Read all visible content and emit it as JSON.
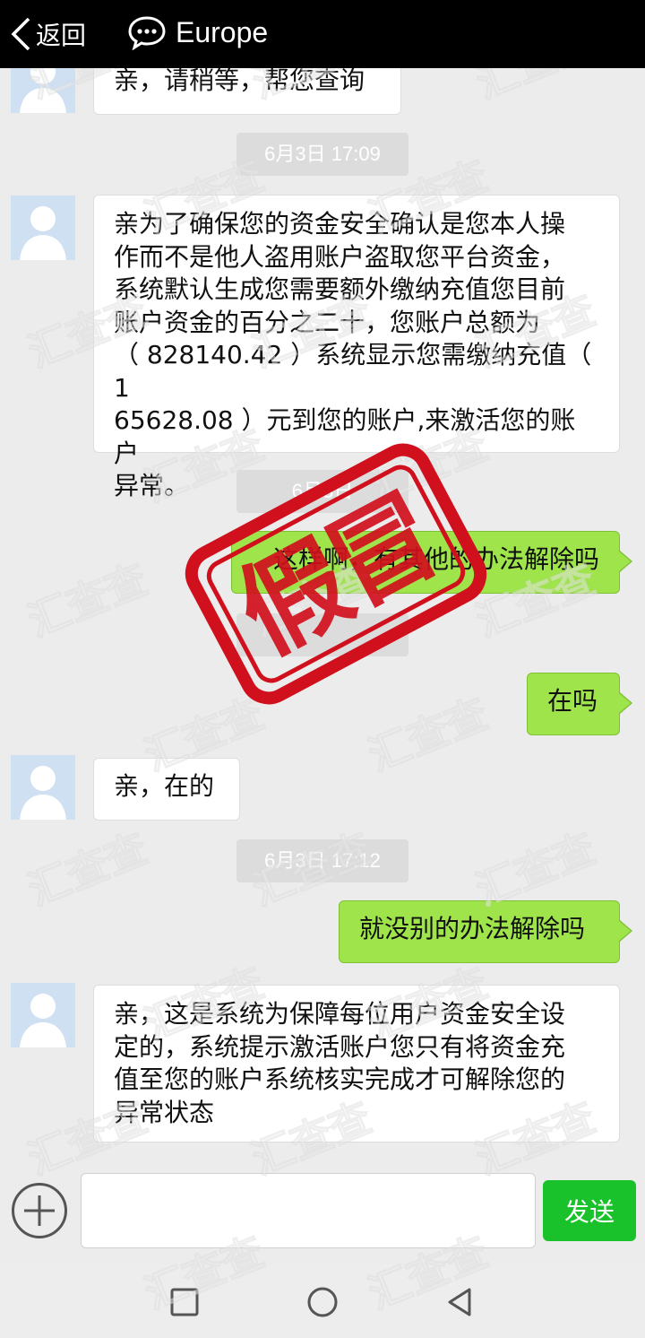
{
  "header": {
    "back_label": "返回",
    "title": "Europe"
  },
  "messages": [
    {
      "sender": "agent",
      "text": "亲，请稍等，帮您查询"
    },
    {
      "timestamp": "6月3日 17:09"
    },
    {
      "sender": "agent",
      "lines": [
        "亲为了确保您的资金安全确认是您本人操",
        "作而不是他人盗用账户盗取您平台资金，",
        "系统默认生成您需要额外缴纳充值您目前",
        "账户资金的百分之二十，您账户总额为",
        "（ 828140.42 ）系统显示您需缴纳充值（ 1",
        "65628.08 ）元到您的账户,来激活您的账户",
        "异常。"
      ]
    },
    {
      "timestamp": "6月3日"
    },
    {
      "sender": "me",
      "text": "这样啊，有其他的办法解除吗"
    },
    {
      "sender": "me",
      "text": "在吗"
    },
    {
      "sender": "agent",
      "text": "亲，在的"
    },
    {
      "timestamp": "6月3日 17:12"
    },
    {
      "sender": "me",
      "text": "就没别的办法解除吗"
    },
    {
      "sender": "agent",
      "lines": [
        "亲，这是系统为保障每位用户资金安全设",
        "定的，系统提示激活账户您只有将资金充",
        "值至您的账户系统核实完成才可解除您的",
        "异常状态"
      ]
    }
  ],
  "input": {
    "value": "",
    "send_label": "发送"
  },
  "stamp": {
    "text": "假冒",
    "color": "#d0101c"
  },
  "watermark": {
    "text": "汇查查"
  },
  "colors": {
    "my_bubble": "#9ee44a",
    "send_button": "#19c22b",
    "header_bg": "#000000"
  },
  "icons": [
    "chevron-left-icon",
    "chat-bubble-icon",
    "plus-circle-icon",
    "square-icon",
    "circle-icon",
    "triangle-back-icon"
  ]
}
